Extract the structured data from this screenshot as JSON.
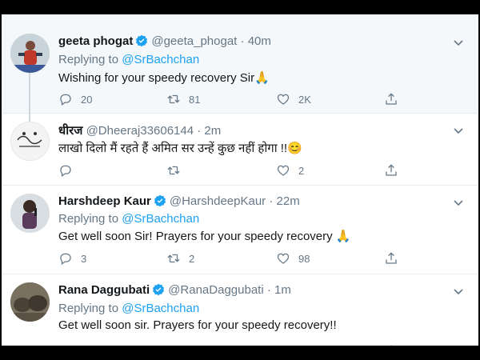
{
  "tweets": [
    {
      "name": "geeta phogat",
      "verified": true,
      "handle": "@geeta_phogat",
      "sep": "·",
      "time": "40m",
      "replying_label": "Replying to",
      "replying_to": "@SrBachchan",
      "text": "Wishing for your speedy recovery Sir🙏",
      "replies": "20",
      "retweets": "81",
      "likes": "2K"
    },
    {
      "name": "धीरज",
      "verified": false,
      "handle": "@Dheeraj33606144",
      "sep": "·",
      "time": "2m",
      "text": "लाखो दिलो मैं रहते हैं अमित सर उन्हें कुछ नहीं होगा !!😊",
      "replies": "",
      "retweets": "",
      "likes": "2"
    },
    {
      "name": "Harshdeep Kaur",
      "verified": true,
      "handle": "@HarshdeepKaur",
      "sep": "·",
      "time": "22m",
      "replying_label": "Replying to",
      "replying_to": "@SrBachchan",
      "text": "Get well soon Sir! Prayers for your speedy recovery 🙏",
      "replies": "3",
      "retweets": "2",
      "likes": "98"
    },
    {
      "name": "Rana Daggubati",
      "verified": true,
      "handle": "@RanaDaggubati",
      "sep": "·",
      "time": "1m",
      "replying_label": "Replying to",
      "replying_to": "@SrBachchan",
      "text": "Get well soon sir. Prayers for your speedy recovery!!"
    }
  ],
  "colors": {
    "accent": "#1da1f2",
    "muted": "#657786",
    "text": "#14171a",
    "highlight_bg": "#f5f8fa"
  },
  "icons": [
    "verified-icon",
    "chevron-down-icon",
    "reply-icon",
    "retweet-icon",
    "like-icon",
    "share-icon"
  ]
}
